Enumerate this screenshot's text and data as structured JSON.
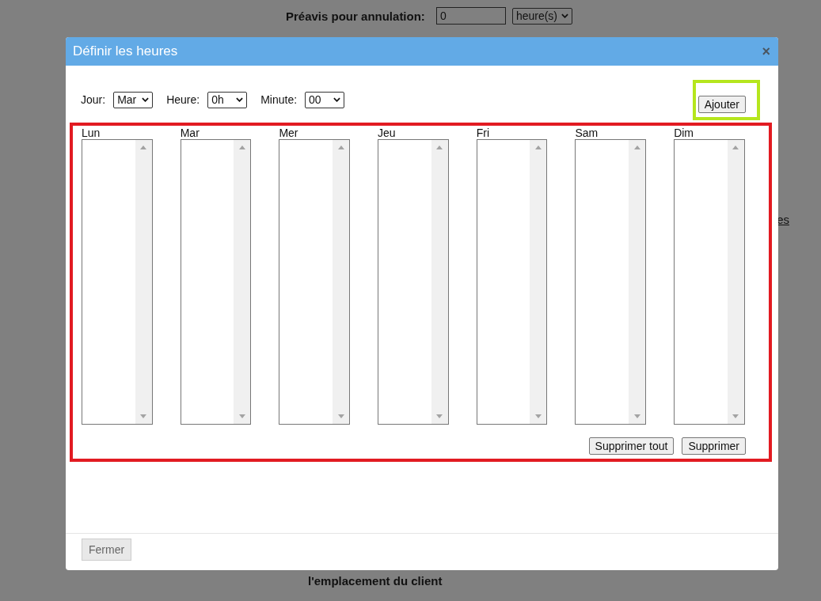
{
  "background": {
    "notice_label": "Préavis pour annulation:",
    "notice_value": "0",
    "notice_unit": "heure(s)",
    "right_fragment": "es",
    "bottom_text": "l'emplacement du client"
  },
  "dialog": {
    "title": "Définir les heures",
    "close": "×",
    "controls": [
      {
        "label": "Jour:",
        "value": "Mar"
      },
      {
        "label": "Heure:",
        "value": "0h"
      },
      {
        "label": "Minute:",
        "value": "00"
      }
    ],
    "add_button": "Ajouter",
    "days": [
      {
        "label": "Lun"
      },
      {
        "label": "Mar"
      },
      {
        "label": "Mer"
      },
      {
        "label": "Jeu"
      },
      {
        "label": "Fri"
      },
      {
        "label": "Sam"
      },
      {
        "label": "Dim"
      }
    ],
    "buttons": [
      "Supprimer tout",
      "Supprimer"
    ],
    "footer_button": {
      "label": "Fermer",
      "disabled": true
    }
  }
}
